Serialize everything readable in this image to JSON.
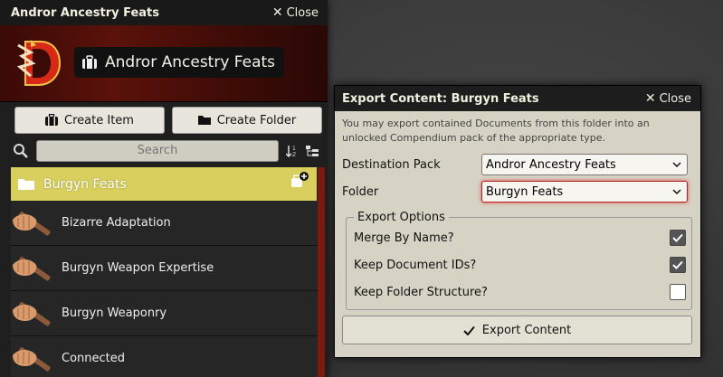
{
  "compendium": {
    "title": "Andror Ancestry Feats",
    "close_label": "Close",
    "banner_title": "Andror Ancestry Feats",
    "create_item_label": "Create Item",
    "create_folder_label": "Create Folder",
    "search_placeholder": "Search",
    "folder": {
      "name": "Burgyn Feats",
      "color": "#d8cf5e"
    },
    "items": [
      {
        "label": "Bizarre Adaptation"
      },
      {
        "label": "Burgyn Weapon Expertise"
      },
      {
        "label": "Burgyn Weaponry"
      },
      {
        "label": "Connected"
      }
    ]
  },
  "dialog": {
    "title": "Export Content: Burgyn Feats",
    "close_label": "Close",
    "hint": "You may export contained Documents from this folder into an unlocked Compendium pack of the appropriate type.",
    "destination_label": "Destination Pack",
    "destination_value": "Andror Ancestry Feats",
    "folder_label": "Folder",
    "folder_value": "Burgyn Feats",
    "options_legend": "Export Options",
    "options": [
      {
        "label": "Merge By Name?",
        "checked": true
      },
      {
        "label": "Keep Document IDs?",
        "checked": true
      },
      {
        "label": "Keep Folder Structure?",
        "checked": false
      }
    ],
    "export_label": "Export Content"
  }
}
